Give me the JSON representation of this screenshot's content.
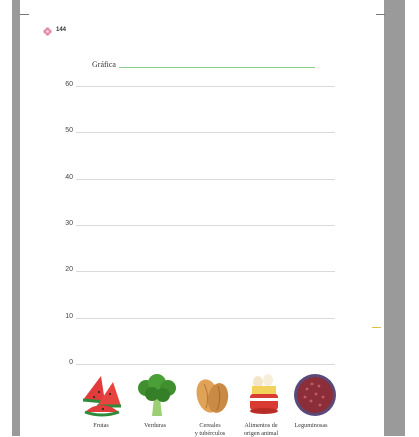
{
  "page": {
    "number": "144"
  },
  "chart_data": {
    "type": "bar",
    "title": "Gráfica",
    "yticks": [
      "60",
      "50",
      "40",
      "30",
      "20",
      "10",
      "0"
    ],
    "ylim": [
      0,
      60
    ],
    "categories": [
      {
        "line1": "",
        "line2": "Frutas",
        "icon": "watermelon-icon"
      },
      {
        "line1": "",
        "line2": "Verduras",
        "icon": "broccoli-icon"
      },
      {
        "line1": "Cereales",
        "line2": "y tubérculos",
        "icon": "bread-icon"
      },
      {
        "line1": "Alimentos de",
        "line2": "origen animal",
        "icon": "egg-cheese-icon"
      },
      {
        "line1": "",
        "line2": "Leguminosas",
        "icon": "beans-icon"
      }
    ],
    "values": [],
    "colors": {
      "gridline": "#d9d9d9",
      "title_line": "#8bcf8f",
      "page_mark": "#e28aa8"
    }
  }
}
